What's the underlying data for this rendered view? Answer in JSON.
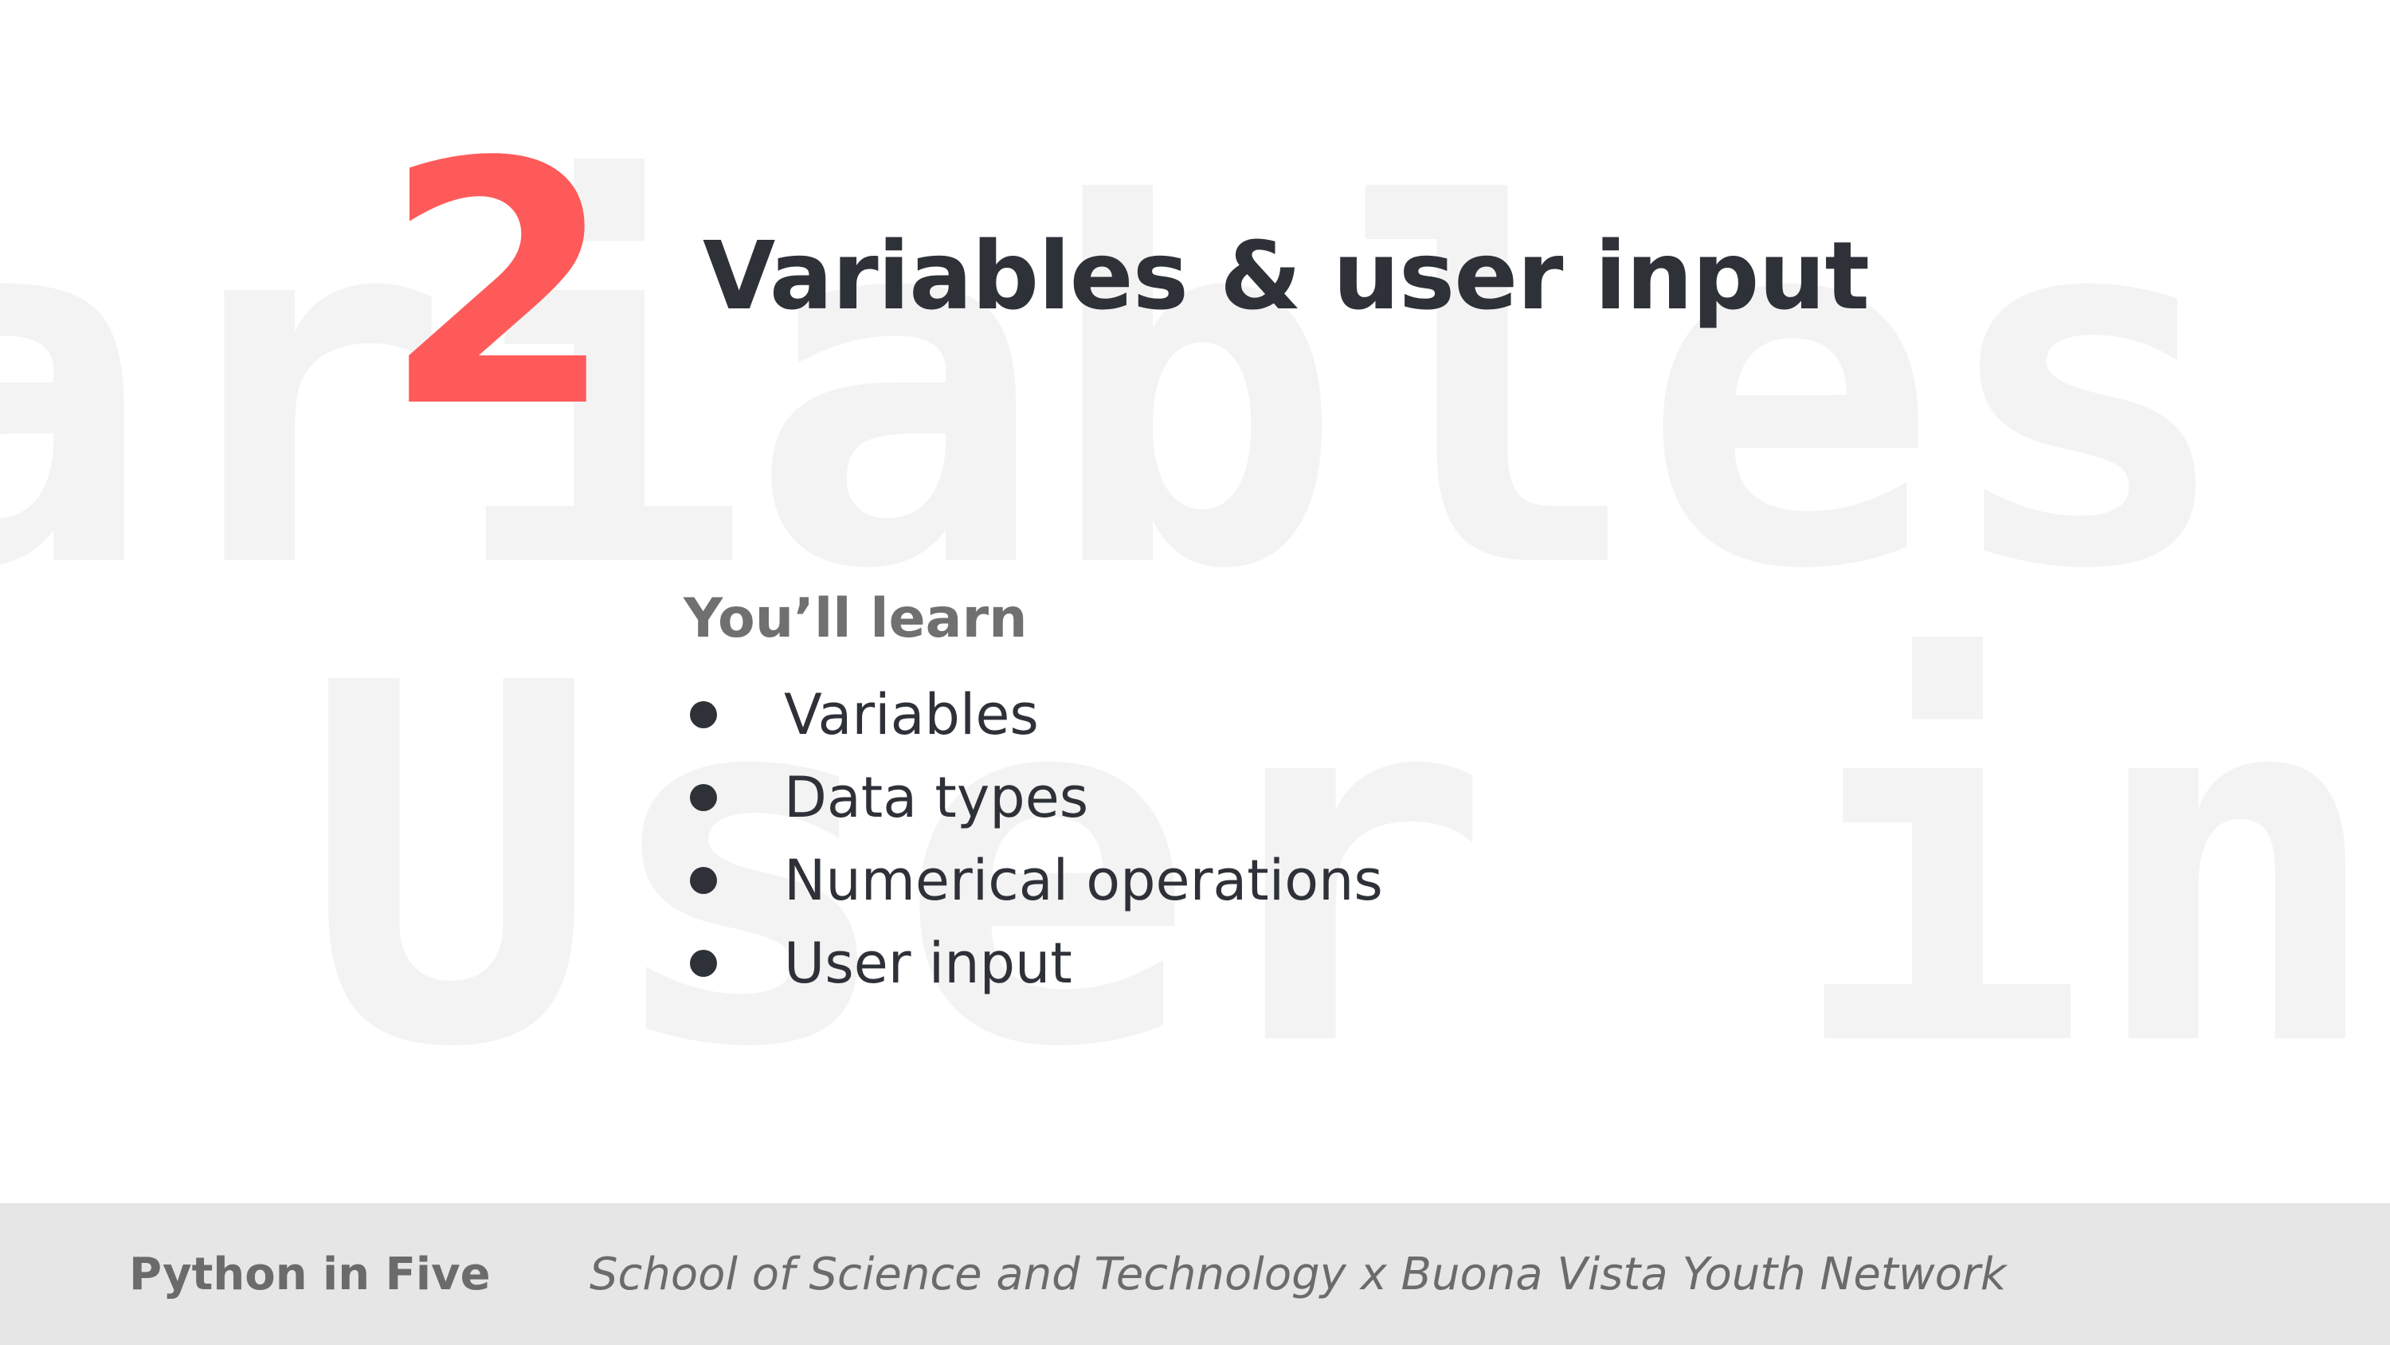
{
  "background": {
    "watermark_line_1": "ariables",
    "watermark_line_2": "User inp"
  },
  "chapter": {
    "number": "2",
    "title": "Variables & user input"
  },
  "learn": {
    "heading": "You’ll learn",
    "items": [
      "Variables",
      "Data types",
      "Numerical operations",
      "User input"
    ]
  },
  "footer": {
    "brand": "Python in Five",
    "credit": "School of Science and Technology x Buona Vista Youth Network"
  },
  "colors": {
    "accent": "#ff5a5a",
    "text_dark": "#2e3138",
    "text_muted": "#707070",
    "footer_bg": "#e6e6e6",
    "watermark": "#f3f3f3"
  }
}
